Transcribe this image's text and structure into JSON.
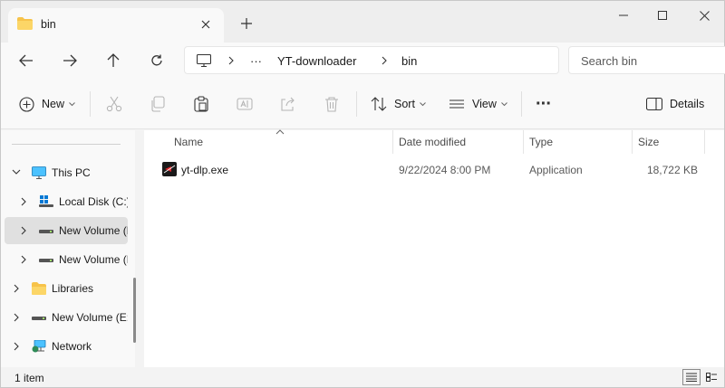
{
  "window": {
    "tab_title": "bin",
    "new_tab_glyph": "+"
  },
  "address": {
    "overflow": "···",
    "crumbs": [
      "YT-downloader",
      "bin"
    ]
  },
  "search": {
    "placeholder": "Search bin"
  },
  "toolbar": {
    "new_label": "New",
    "sort_label": "Sort",
    "view_label": "View",
    "more_glyph": "···",
    "details_label": "Details"
  },
  "sidebar": {
    "items": [
      {
        "label": "This PC",
        "icon": "monitor-icon"
      },
      {
        "label": "Local Disk (C:)",
        "icon": "windows-drive-icon"
      },
      {
        "label": "New Volume (D:)",
        "icon": "drive-icon"
      },
      {
        "label": "New Volume (F:)",
        "icon": "drive-icon"
      },
      {
        "label": "Libraries",
        "icon": "libraries-icon"
      },
      {
        "label": "New Volume (E:)",
        "icon": "drive-icon"
      },
      {
        "label": "Network",
        "icon": "network-icon"
      }
    ]
  },
  "columns": {
    "name": "Name",
    "date": "Date modified",
    "type": "Type",
    "size": "Size"
  },
  "files": [
    {
      "name": "yt-dlp.exe",
      "date": "9/22/2024 8:00 PM",
      "type": "Application",
      "size": "18,722 KB"
    }
  ],
  "status": {
    "count": "1 item"
  },
  "colors": {
    "accent": "#0067c0",
    "folder": "#f7c34a",
    "selected": "#e0e0e0"
  }
}
